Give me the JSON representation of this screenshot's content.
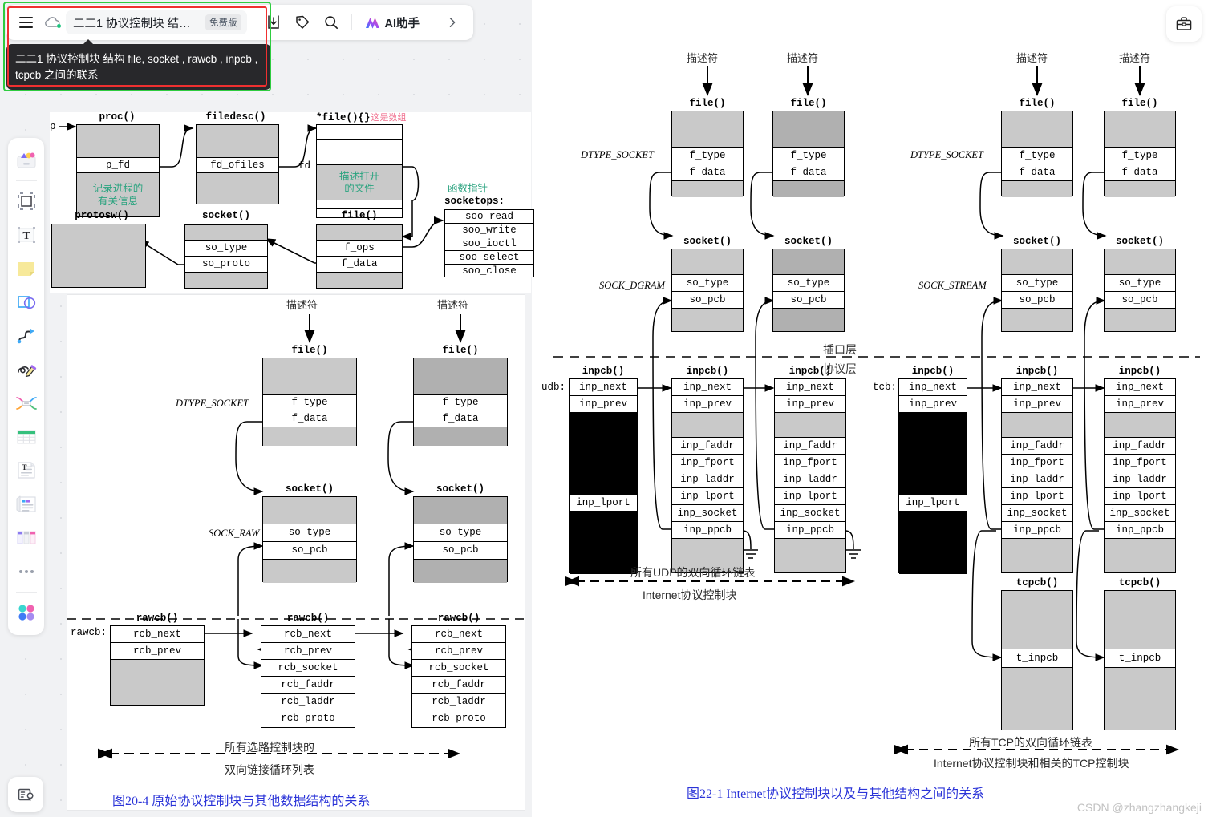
{
  "app": {
    "topbar": {
      "menu_icon": "hamburger-icon",
      "cloud_icon": "cloud-sync-icon",
      "doc_title": "二二1 协议控制块 结构 file..",
      "free_badge": "免费版",
      "import_icon": "import-icon",
      "tag_icon": "tag-icon",
      "search_icon": "search-icon",
      "ai_icon": "ai-sparkle-icon",
      "ai_label": "AI助手",
      "expand_icon": "chevron-right-icon"
    },
    "tooltip": "二二1 协议控制块 结构 file, socket , rawcb , inpcb , tcpcb 之间的联系",
    "briefcase_icon": "briefcase-icon",
    "present_icon": "present-screen-icon",
    "selection_colors": {
      "outer": "#2ecc3f",
      "inner": "#f03030"
    },
    "rail": [
      {
        "name": "templates-icon",
        "label": "模板"
      },
      {
        "name": "frame-icon",
        "label": "画框"
      },
      {
        "name": "text-icon",
        "label": "文本"
      },
      {
        "name": "sticky-note-icon",
        "label": "便签"
      },
      {
        "name": "shape-icon",
        "label": "形状"
      },
      {
        "name": "curve-line-icon",
        "label": "连线"
      },
      {
        "name": "pen-icon",
        "label": "画笔"
      },
      {
        "name": "mindmap-icon",
        "label": "思维导图"
      },
      {
        "name": "table-icon",
        "label": "表格"
      },
      {
        "name": "doc-text-icon",
        "label": "文档"
      },
      {
        "name": "media-card-icon",
        "label": "卡片"
      },
      {
        "name": "kanban-icon",
        "label": "看板"
      },
      {
        "name": "more-icon",
        "label": "更多"
      },
      {
        "name": "apps-icon",
        "label": "应用"
      }
    ]
  },
  "chart_data": {
    "type": "diagram",
    "title": "二二1 协议控制块 结构 file, socket , rawcb , inpcb , tcpcb 之间的联系",
    "figures": [
      {
        "id": "fig-proc",
        "caption": "",
        "structs": [
          {
            "name": "proc()",
            "fields": [
              "",
              "p_fd",
              "记录进程的 有关信息"
            ]
          },
          {
            "name": "filedesc()",
            "fields": [
              "",
              "fd_ofiles",
              ""
            ]
          },
          {
            "name": "*file(){}",
            "note": "这是数组",
            "fields": [
              "",
              "",
              "",
              "描述打开 的文件",
              "",
              ""
            ]
          },
          {
            "name": "protosw()",
            "fields": [
              ""
            ]
          },
          {
            "name": "socket()",
            "fields": [
              "",
              "so_type",
              "so_proto",
              ""
            ]
          },
          {
            "name": "file()",
            "fields": [
              "",
              "f_ops",
              "f_data",
              ""
            ]
          },
          {
            "name": "socketops:",
            "note": "函数指针",
            "fields": [
              "soo_read",
              "soo_write",
              "soo_ioctl",
              "soo_select",
              "soo_close"
            ]
          }
        ],
        "labels": [
          "p",
          "fd"
        ]
      },
      {
        "id": "fig-20-4",
        "caption": "图20-4  原始协议控制块与其他数据结构的关系",
        "top_labels": [
          "描述符",
          "描述符"
        ],
        "side_labels": [
          "DTYPE_SOCKET",
          "SOCK_RAW",
          "rawcb:"
        ],
        "structs": [
          {
            "name": "file()",
            "fields": [
              "",
              "f_type",
              "f_data",
              ""
            ]
          },
          {
            "name": "socket()",
            "fields": [
              "",
              "so_type",
              "so_pcb",
              ""
            ]
          },
          {
            "name": "rawcb()",
            "fields": [
              "rcb_next",
              "rcb_prev",
              ""
            ]
          },
          {
            "name": "rawcb()",
            "fields": [
              "rcb_next",
              "rcb_prev",
              "rcb_socket",
              "rcb_faddr",
              "rcb_laddr",
              "rcb_proto"
            ]
          }
        ],
        "footnote": "所有选路控制块的 双向链接循环列表"
      },
      {
        "id": "fig-22-1",
        "caption": "图22-1   Internet协议控制块以及与其他结构之间的关系",
        "top_labels": [
          "描述符",
          "描述符",
          "描述符",
          "描述符"
        ],
        "side_labels": [
          "DTYPE_SOCKET",
          "SOCK_DGRAM",
          "DTYPE_SOCKET",
          "SOCK_STREAM",
          "udb:",
          "tcb:"
        ],
        "layer_labels": [
          "插口层",
          "协议层"
        ],
        "structs": [
          {
            "name": "file()",
            "fields": [
              "",
              "f_type",
              "f_data",
              ""
            ]
          },
          {
            "name": "socket()",
            "fields": [
              "",
              "so_type",
              "so_pcb",
              ""
            ]
          },
          {
            "name": "inpcb()",
            "fields": [
              "inp_next",
              "inp_prev",
              "",
              "inp_lport",
              ""
            ]
          },
          {
            "name": "inpcb()",
            "fields": [
              "inp_next",
              "inp_prev",
              "",
              "inp_faddr",
              "inp_fport",
              "inp_laddr",
              "inp_lport",
              "inp_socket",
              "inp_ppcb",
              ""
            ]
          },
          {
            "name": "tcpcb()",
            "fields": [
              "",
              "t_inpcb",
              ""
            ]
          }
        ],
        "footnote_udp": "所有UDP的双向循环链表 Internet协议控制块",
        "footnote_tcp": "所有TCP的双向循环链表 Internet协议控制块和相关的TCP控制块"
      }
    ]
  },
  "fig_proc": {
    "label_p": "p",
    "label_fd": "fd",
    "proc": {
      "title": "proc()",
      "p_fd": "p_fd",
      "note": "记录进程的",
      "note2": "有关信息"
    },
    "filedesc": {
      "title": "filedesc()",
      "fd_ofiles": "fd_ofiles"
    },
    "filearr": {
      "title": "*file(){}",
      "note_red": "这是数组",
      "desc1": "描述打开",
      "desc2": "的文件"
    },
    "protosw": {
      "title": "protosw()"
    },
    "socket": {
      "title": "socket()",
      "so_type": "so_type",
      "so_proto": "so_proto"
    },
    "file": {
      "title": "file()",
      "f_ops": "f_ops",
      "f_data": "f_data"
    },
    "socketops": {
      "note_green": "函数指针",
      "title": "socketops:",
      "rows": [
        "soo_read",
        "soo_write",
        "soo_ioctl",
        "soo_select",
        "soo_close"
      ]
    }
  },
  "fig204": {
    "desc_label": "描述符",
    "file_title": "file()",
    "f_type": "f_type",
    "f_data": "f_data",
    "dtype_socket": "DTYPE_SOCKET",
    "socket_title": "socket()",
    "so_type": "so_type",
    "so_pcb": "so_pcb",
    "sock_raw": "SOCK_RAW",
    "rawcb_label": "rawcb:",
    "rawcb_title": "rawcb()",
    "rcb_next": "rcb_next",
    "rcb_prev": "rcb_prev",
    "rcb_socket": "rcb_socket",
    "rcb_faddr": "rcb_faddr",
    "rcb_laddr": "rcb_laddr",
    "rcb_proto": "rcb_proto",
    "foot1": "所有选路控制块的",
    "foot2": "双向链接循环列表",
    "caption": "图20-4   原始协议控制块与其他数据结构的关系"
  },
  "fig221": {
    "desc_label": "描述符",
    "file_title": "file()",
    "f_type": "f_type",
    "f_data": "f_data",
    "dtype_socket": "DTYPE_SOCKET",
    "socket_title": "socket()",
    "so_type": "so_type",
    "so_pcb": "so_pcb",
    "sock_dgram": "SOCK_DGRAM",
    "sock_stream": "SOCK_STREAM",
    "layer_top": "插口层",
    "layer_bottom": "协议层",
    "udb_label": "udb:",
    "tcb_label": "tcb:",
    "inpcb_title": "inpcb()",
    "inp_next": "inp_next",
    "inp_prev": "inp_prev",
    "inp_faddr": "inp_faddr",
    "inp_fport": "inp_fport",
    "inp_laddr": "inp_laddr",
    "inp_lport": "inp_lport",
    "inp_socket": "inp_socket",
    "inp_ppcb": "inp_ppcb",
    "tcpcb_title": "tcpcb()",
    "t_inpcb": "t_inpcb",
    "udp_foot1": "所有UDP的双向循环链表",
    "udp_foot2": "Internet协议控制块",
    "tcp_foot1": "所有TCP的双向循环链表",
    "tcp_foot2": "Internet协议控制块和相关的TCP控制块",
    "caption": "图22-1   Internet协议控制块以及与其他结构之间的关系"
  },
  "watermark": "CSDN @zhangzhangkeji"
}
